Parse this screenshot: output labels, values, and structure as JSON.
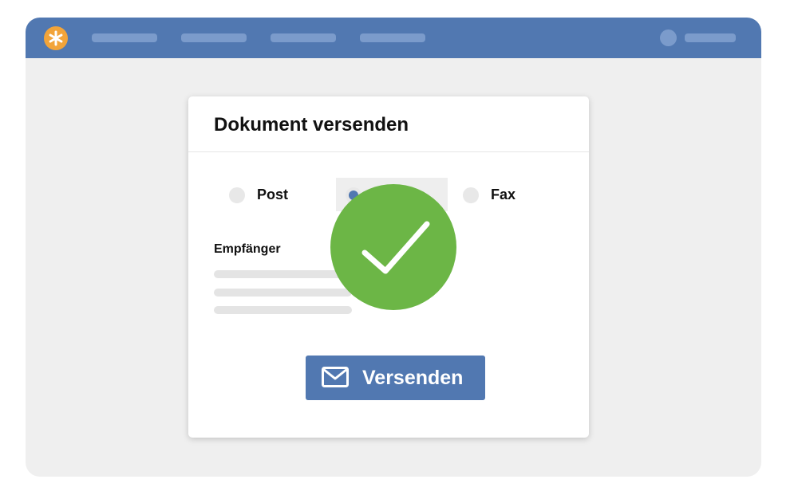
{
  "colors": {
    "topbar": "#5178b1",
    "nav_placeholder": "#7b9bcb",
    "logo": "#f2a43a",
    "window_background": "#efefef",
    "button": "#5178b1",
    "success": "#6cb646"
  },
  "topbar": {
    "logo_icon": "asterisk-icon",
    "nav_items": [
      "",
      "",
      "",
      ""
    ],
    "user": {
      "avatar_icon": "avatar-icon",
      "name": ""
    }
  },
  "dialog": {
    "title": "Dokument versenden",
    "delivery_options": [
      {
        "label": "Post",
        "selected": false
      },
      {
        "label": "",
        "selected": true
      },
      {
        "label": "Fax",
        "selected": false
      }
    ],
    "recipient_label": "Empfänger",
    "recipient_lines": 3,
    "send_button": {
      "label": "Versenden",
      "icon": "envelope-icon"
    }
  },
  "overlay": {
    "icon": "checkmark-icon",
    "status": "success"
  }
}
